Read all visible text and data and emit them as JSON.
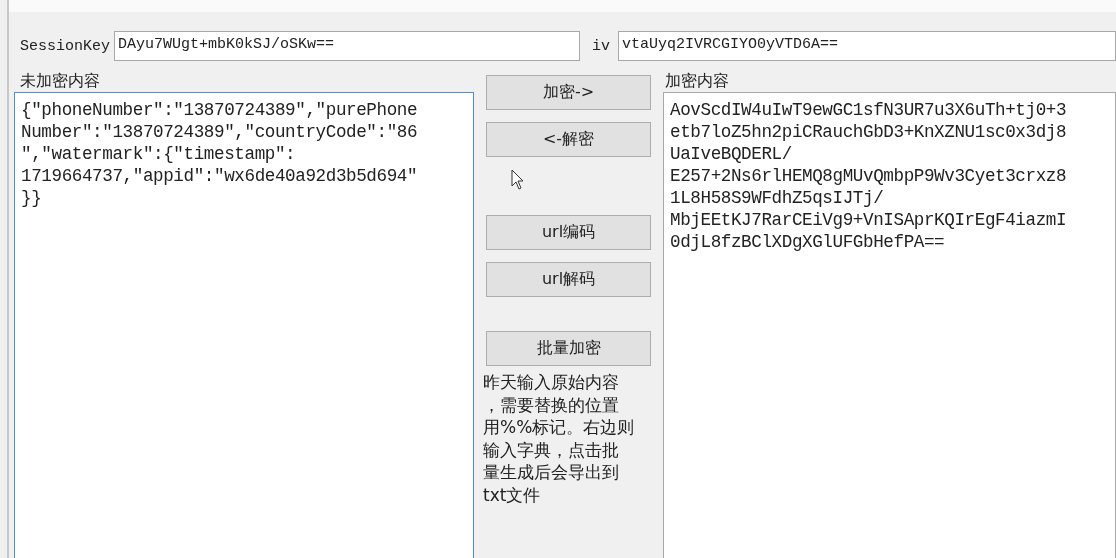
{
  "session_key": {
    "label": "SessionKey",
    "value": "DAyu7WUgt+mbK0kSJ/oSKw=="
  },
  "iv": {
    "label": "iv",
    "value": "vtaUyq2IVRCGIYO0yVTD6A=="
  },
  "plain": {
    "label": "未加密内容",
    "lines": [
      "{\"phoneNumber\":\"13870724389\",\"purePhone",
      "Number\":\"13870724389\",\"countryCode\":\"86",
      "\",\"watermark\":{\"timestamp\":",
      "1719664737,\"appid\":\"wx6de40a92d3b5d694\"",
      "}}"
    ]
  },
  "cipher": {
    "label": "加密内容",
    "lines": [
      "AovScdIW4uIwT9ewGC1sfN3UR7u3X6uTh+tj0+3",
      "etb7loZ5hn2piCRauchGbD3+KnXZNU1sc0x3dj8",
      "UaIveBQDERL/",
      "E257+2Ns6rlHEMQ8gMUvQmbpP9Wv3Cyet3crxz8",
      "1L8H58S9WFdhZ5qsIJTj/",
      "MbjEEtKJ7RarCEiVg9+VnISAprKQIrEgF4iazmI",
      "0djL8fzBClXDgXGlUFGbHefPA=="
    ]
  },
  "buttons": [
    {
      "label": "加密->",
      "kind": "encrypt"
    },
    {
      "label": "<-解密",
      "kind": "decrypt"
    },
    {
      "label": "url编码",
      "kind": "url-encode"
    },
    {
      "label": "url解码",
      "kind": "url-decode"
    },
    {
      "label": "批量加密",
      "kind": "batch"
    }
  ],
  "hint": [
    "昨天输入原始内容",
    "，需要替换的位置",
    "用%%标记。右边则",
    "输入字典，点击批",
    "量生成后会导出到",
    "txt文件"
  ]
}
